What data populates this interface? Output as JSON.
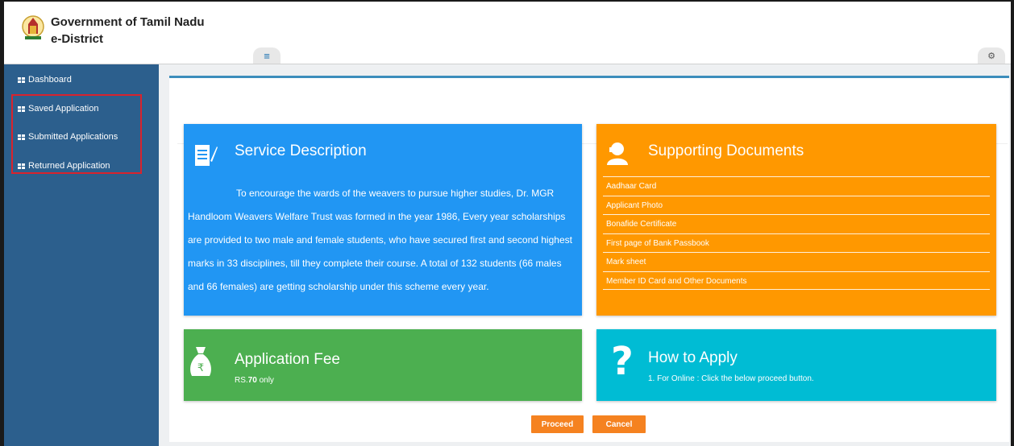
{
  "header": {
    "title_line1": "Government of Tamil Nadu",
    "title_line2": "e-District",
    "menu_glyph": "≡",
    "settings_glyph": "⚙"
  },
  "sidebar": {
    "items": [
      {
        "label": "Dashboard",
        "icon": "grid-icon"
      },
      {
        "label": "Saved Application",
        "icon": "grid-icon"
      },
      {
        "label": "Submitted Applications",
        "icon": "grid-icon"
      },
      {
        "label": "Returned Application",
        "icon": "grid-icon"
      }
    ]
  },
  "service": {
    "title": "Service Description",
    "icon": "document-edit-icon",
    "description": "To encourage the wards of the weavers to pursue higher studies, Dr. MGR Handloom Weavers Welfare Trust was formed in the year 1986, Every year scholarships are provided to two male and female students, who have secured first and second highest marks in 33 disciplines, till they complete their course. A total of 132 students (66 males and 66 females) are getting scholarship under this scheme every year."
  },
  "documents": {
    "title": "Supporting Documents",
    "icon": "user-icon",
    "items": [
      "Aadhaar Card",
      "Applicant Photo",
      "Bonafide Certificate",
      "First page of Bank Passbook",
      "Mark sheet",
      "Member ID Card and Other Documents"
    ]
  },
  "fee": {
    "title": "Application Fee",
    "icon": "money-bag-icon",
    "prefix": "RS.",
    "amount": "70",
    "suffix": " only"
  },
  "apply": {
    "title": "How to Apply",
    "icon": "question-icon",
    "text": "1. For Online : Click the below proceed button."
  },
  "actions": {
    "proceed": "Proceed",
    "cancel": "Cancel"
  },
  "colors": {
    "sidebar": "#2c5f8d",
    "service_card": "#2196f3",
    "documents_card": "#ff9800",
    "fee_card": "#4caf50",
    "apply_card": "#00bcd4",
    "button": "#f58220",
    "highlight": "#d9232d"
  }
}
